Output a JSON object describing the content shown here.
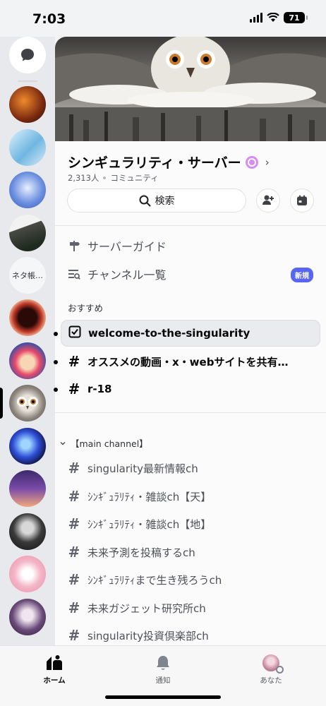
{
  "status_bar": {
    "time": "7:03",
    "battery": "71"
  },
  "rail": {
    "folder_label": "ネタ帳…"
  },
  "server": {
    "name": "シンギュラリティ・サーバー",
    "member_count": "2,313人",
    "type": "コミュニティ",
    "search_label": "検索"
  },
  "nav": {
    "server_guide": "サーバーガイド",
    "channel_list": "チャンネル一覧",
    "new_badge": "新規"
  },
  "recommended": {
    "heading": "おすすめ",
    "channels": [
      {
        "name": "welcome-to-the-singularity",
        "icon": "rules-icon"
      },
      {
        "name": "オススメの動画・x・webサイトを共有…",
        "icon": "hash-icon"
      },
      {
        "name": "r-18",
        "icon": "nsfw-hash-icon"
      }
    ]
  },
  "category": {
    "name": "【main channel】",
    "channels": [
      "singularity最新情報ch",
      "ｼﾝｷﾞｭﾗﾘﾃｨ・雑談ch【天】",
      "ｼﾝｷﾞｭﾗﾘﾃｨ・雑談ch【地】",
      "未来予測を投稿するch",
      "ｼﾝｷﾞｭﾗﾘﾃｨまで生き残ろうch",
      "未来ガジェット研究所ch",
      "singularity投資倶楽部ch"
    ]
  },
  "tabs": {
    "home": "ホーム",
    "notifications": "通知",
    "you": "あなた"
  },
  "colors": {
    "accent": "#5865f2",
    "boost": "#d78cf4"
  }
}
